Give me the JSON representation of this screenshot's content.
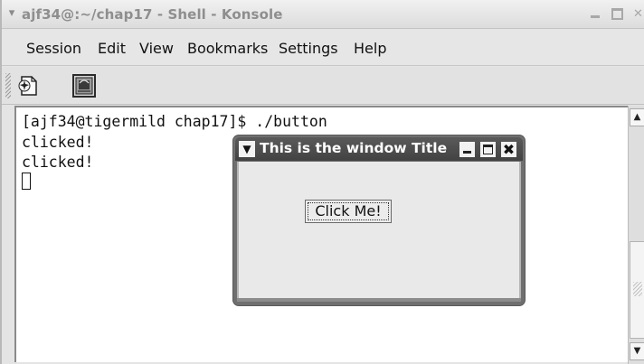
{
  "window": {
    "title": "ajf34@:~/chap17 - Shell - Konsole"
  },
  "menubar": {
    "items": [
      "Session",
      "Edit",
      "View",
      "Bookmarks",
      "Settings",
      "Help"
    ]
  },
  "toolbar": {
    "icons": [
      "new-session-icon",
      "konsole-icon"
    ]
  },
  "terminal": {
    "lines": [
      "[ajf34@tigermild chap17]$ ./button",
      "clicked!",
      "clicked!"
    ]
  },
  "dialog": {
    "title": "This is the window Title",
    "button_label": "Click Me!"
  },
  "colors": {
    "dialog_titlebar": "#4a4a4a",
    "terminal_bg": "#ffffff",
    "chrome": "#e4e4e4"
  }
}
